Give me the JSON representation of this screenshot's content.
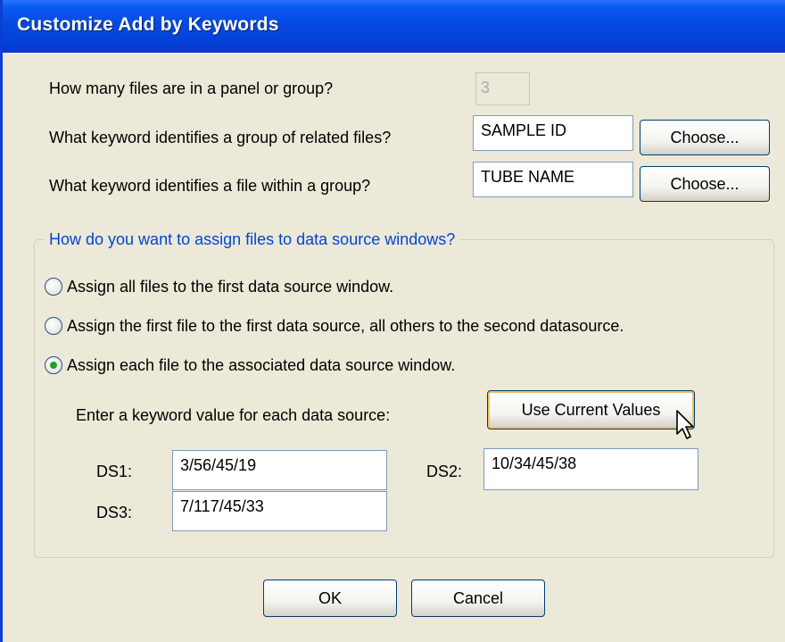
{
  "window": {
    "title": "Customize Add by Keywords",
    "titlebar_color": "#0549e0",
    "background": "#ece9d8"
  },
  "questions": {
    "files_per_group": {
      "label": "How many files are in a panel or group?",
      "value": "3"
    },
    "group_keyword": {
      "label": "What keyword identifies a group of related files?",
      "value": "SAMPLE ID",
      "button": "Choose..."
    },
    "file_keyword": {
      "label": "What keyword identifies a file within a group?",
      "value": "TUBE NAME",
      "button": "Choose..."
    }
  },
  "assign": {
    "group_title": "How do you want to assign files to data source windows?",
    "title_color": "#0046d5",
    "options": [
      {
        "label": "Assign all files to the first data source window.",
        "selected": false
      },
      {
        "label": "Assign the first file to the first data source, all others to the second datasource.",
        "selected": false
      },
      {
        "label": "Assign each file to the associated data source window.",
        "selected": true
      }
    ],
    "enter_label": "Enter a keyword value for each data source:",
    "use_current_button": "Use Current Values",
    "ds": [
      {
        "label": "DS1:",
        "value": "3/56/45/19"
      },
      {
        "label": "DS2:",
        "value": "10/34/45/38"
      },
      {
        "label": "DS3:",
        "value": "7/117/45/33"
      }
    ]
  },
  "buttons": {
    "ok": "OK",
    "cancel": "Cancel"
  }
}
